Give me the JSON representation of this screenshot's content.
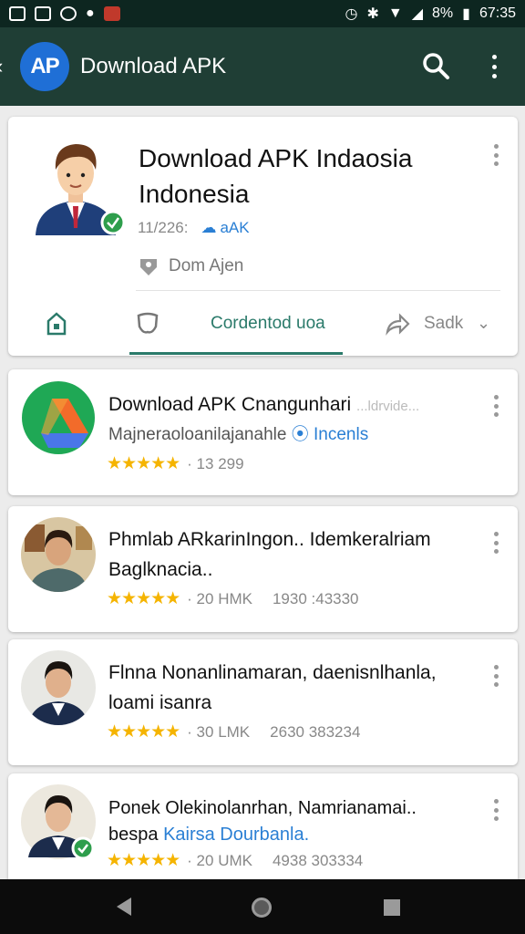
{
  "status_bar": {
    "battery": "8%",
    "time": "67:35"
  },
  "app_bar": {
    "logo_text": "AP",
    "title": "Download APK"
  },
  "featured": {
    "title": "Download APK Indaosia Indonesia",
    "version": "11/226:",
    "apk_tag": "aAK",
    "developer": "Dom Ajen",
    "active_tab": "Cordentod uoa",
    "share_label": "Sadk"
  },
  "list": [
    {
      "title": "Download APK Cnangunhari",
      "title_overflow": "...ldrvide...",
      "subtitle": "Majneraoloanilajanahle",
      "subtitle_link": "Incenls",
      "stars": "★★★★★",
      "meta": "· 13  299",
      "extra": ""
    },
    {
      "title": "Phmlab ARkarinIngon.. Idemkeralriam Baglknacia..",
      "stars": "★★★★★",
      "meta": "· 20  HMK",
      "extra": "1930 :43330"
    },
    {
      "title": "Flnna Nonanlinamaran, daenisnlhanla, loami isanra",
      "stars": "★★★★★",
      "meta": "· 30  LMK",
      "extra": "2630 383234"
    },
    {
      "title": "Ponek Olekinolanrhan, Namrianamai..",
      "subtitle_prefix": "bespa",
      "subtitle_link": "Kairsa Dourbanla.",
      "stars": "★★★★★",
      "meta": "· 20  UMK",
      "extra": "4938 303334"
    }
  ],
  "icons": {
    "search": "search-icon",
    "menu": "more-vert-icon",
    "back": "chevron-left-icon"
  },
  "colors": {
    "status_bar": "#0d2620",
    "app_bar": "#1f3e35",
    "accent": "#2a7a6a",
    "star": "#f5b400",
    "link": "#2a7fd4"
  }
}
